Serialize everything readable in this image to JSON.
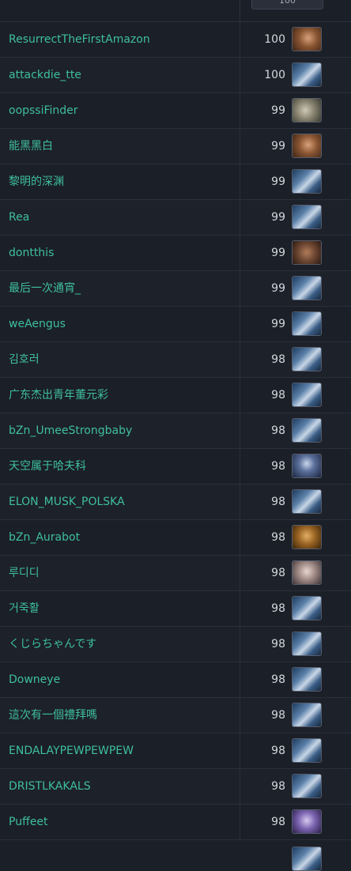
{
  "header": {
    "top_value": "100"
  },
  "rows": [
    {
      "name": "ResurrectTheFirstAmazon",
      "score": "100",
      "avatar": "amazon-portrait"
    },
    {
      "name": "attackdie_tte",
      "score": "100",
      "avatar": "default-portrait"
    },
    {
      "name": "oopssiFinder",
      "score": "99",
      "avatar": "necromancer-portrait"
    },
    {
      "name": "能黑黑白",
      "score": "99",
      "avatar": "amazon-portrait"
    },
    {
      "name": "黎明的深渊",
      "score": "99",
      "avatar": "default-portrait"
    },
    {
      "name": "Rea",
      "score": "99",
      "avatar": "default-portrait"
    },
    {
      "name": "dontthis",
      "score": "99",
      "avatar": "barbarian-portrait"
    },
    {
      "name": "最后一次通宵_",
      "score": "99",
      "avatar": "default-portrait"
    },
    {
      "name": "weAengus",
      "score": "99",
      "avatar": "default-portrait"
    },
    {
      "name": "김호러",
      "score": "98",
      "avatar": "default-portrait"
    },
    {
      "name": "广东杰出青年董元彩",
      "score": "98",
      "avatar": "default-portrait"
    },
    {
      "name": "bZn_UmeeStrongbaby",
      "score": "98",
      "avatar": "default-portrait"
    },
    {
      "name": "天空属于哈夫科",
      "score": "98",
      "avatar": "hooded-portrait"
    },
    {
      "name": "ELON_MUSK_POLSKA",
      "score": "98",
      "avatar": "default-portrait"
    },
    {
      "name": "bZn_Aurabot",
      "score": "98",
      "avatar": "druid-portrait"
    },
    {
      "name": "루디디",
      "score": "98",
      "avatar": "assassin-portrait"
    },
    {
      "name": "거죽활",
      "score": "98",
      "avatar": "default-portrait"
    },
    {
      "name": "くじらちゃんです",
      "score": "98",
      "avatar": "default-portrait"
    },
    {
      "name": "Downeye",
      "score": "98",
      "avatar": "default-portrait"
    },
    {
      "name": "這次有一個禮拜嗎",
      "score": "98",
      "avatar": "default-portrait"
    },
    {
      "name": "ENDALAYPEWPEWPEW",
      "score": "98",
      "avatar": "default-portrait"
    },
    {
      "name": "DRISTLKAKALS",
      "score": "98",
      "avatar": "default-portrait"
    },
    {
      "name": "Puffeet",
      "score": "98",
      "avatar": "sorceress-portrait"
    }
  ],
  "partial_row": {
    "avatar": "default-portrait"
  },
  "colors": {
    "name_link": "#3ebf9f",
    "background": "#1b1f27",
    "score": "#d4d7dd"
  }
}
